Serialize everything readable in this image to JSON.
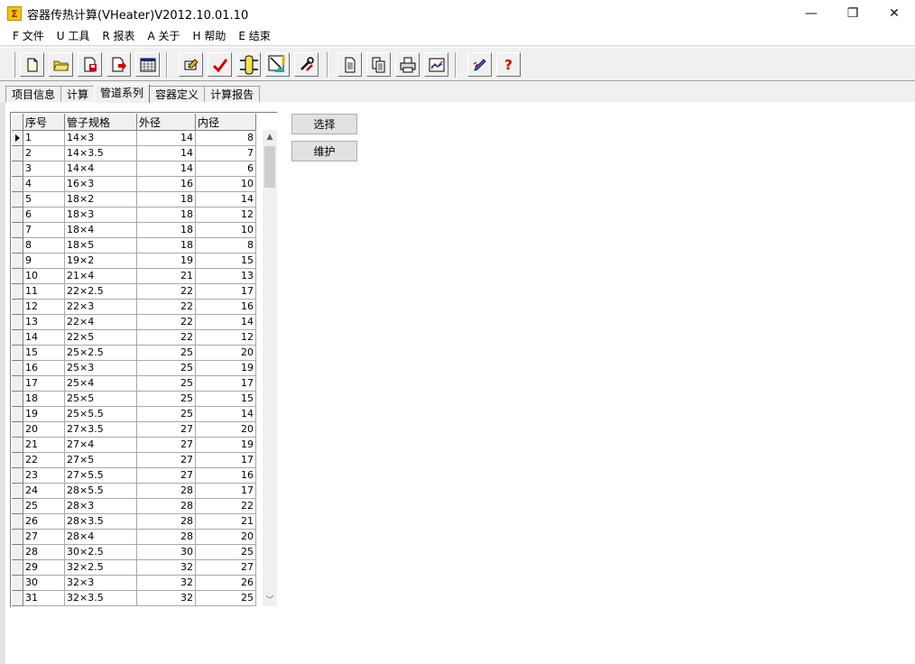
{
  "window": {
    "title": "容器传热计算(VHeater)V2012.10.01.10",
    "icon_glyph": "Σ",
    "controls": {
      "minimize": "—",
      "restore": "❐",
      "close": "✕"
    }
  },
  "menu": [
    "F 文件",
    "U 工具",
    "R 报表",
    "A 关于",
    "H 帮助",
    "E 结束"
  ],
  "toolbar": {
    "icons": [
      "new-file-icon",
      "open-folder-icon",
      "save-icon",
      "export-icon",
      "calendar-table-icon",
      "edit-icon",
      "check-icon",
      "vessel-icon",
      "diagram-icon",
      "tools-icon",
      "document-icon",
      "pages-icon",
      "print-icon",
      "chart-icon",
      "pen-icon",
      "help-icon"
    ],
    "help_glyph": "?"
  },
  "tabs": [
    "项目信息",
    "计算",
    "管道系列",
    "容器定义",
    "计算报告"
  ],
  "active_tab": 2,
  "grid": {
    "columns": [
      "序号",
      "管子规格",
      "外径",
      "内径"
    ],
    "rows": [
      [
        "1",
        "14×3",
        "14",
        "8"
      ],
      [
        "2",
        "14×3.5",
        "14",
        "7"
      ],
      [
        "3",
        "14×4",
        "14",
        "6"
      ],
      [
        "4",
        "16×3",
        "16",
        "10"
      ],
      [
        "5",
        "18×2",
        "18",
        "14"
      ],
      [
        "6",
        "18×3",
        "18",
        "12"
      ],
      [
        "7",
        "18×4",
        "18",
        "10"
      ],
      [
        "8",
        "18×5",
        "18",
        "8"
      ],
      [
        "9",
        "19×2",
        "19",
        "15"
      ],
      [
        "10",
        "21×4",
        "21",
        "13"
      ],
      [
        "11",
        "22×2.5",
        "22",
        "17"
      ],
      [
        "12",
        "22×3",
        "22",
        "16"
      ],
      [
        "13",
        "22×4",
        "22",
        "14"
      ],
      [
        "14",
        "22×5",
        "22",
        "12"
      ],
      [
        "15",
        "25×2.5",
        "25",
        "20"
      ],
      [
        "16",
        "25×3",
        "25",
        "19"
      ],
      [
        "17",
        "25×4",
        "25",
        "17"
      ],
      [
        "18",
        "25×5",
        "25",
        "15"
      ],
      [
        "19",
        "25×5.5",
        "25",
        "14"
      ],
      [
        "20",
        "27×3.5",
        "27",
        "20"
      ],
      [
        "21",
        "27×4",
        "27",
        "19"
      ],
      [
        "22",
        "27×5",
        "27",
        "17"
      ],
      [
        "23",
        "27×5.5",
        "27",
        "16"
      ],
      [
        "24",
        "28×5.5",
        "28",
        "17"
      ],
      [
        "25",
        "28×3",
        "28",
        "22"
      ],
      [
        "26",
        "28×3.5",
        "28",
        "21"
      ],
      [
        "27",
        "28×4",
        "28",
        "20"
      ],
      [
        "28",
        "30×2.5",
        "30",
        "25"
      ],
      [
        "29",
        "32×2.5",
        "32",
        "27"
      ],
      [
        "30",
        "32×3",
        "32",
        "26"
      ],
      [
        "31",
        "32×3.5",
        "32",
        "25"
      ]
    ],
    "selected_row": 0,
    "scroll_up_glyph": "▲",
    "scroll_down_glyph": "﹀"
  },
  "buttons": {
    "select": "选择",
    "maintain": "维护"
  }
}
